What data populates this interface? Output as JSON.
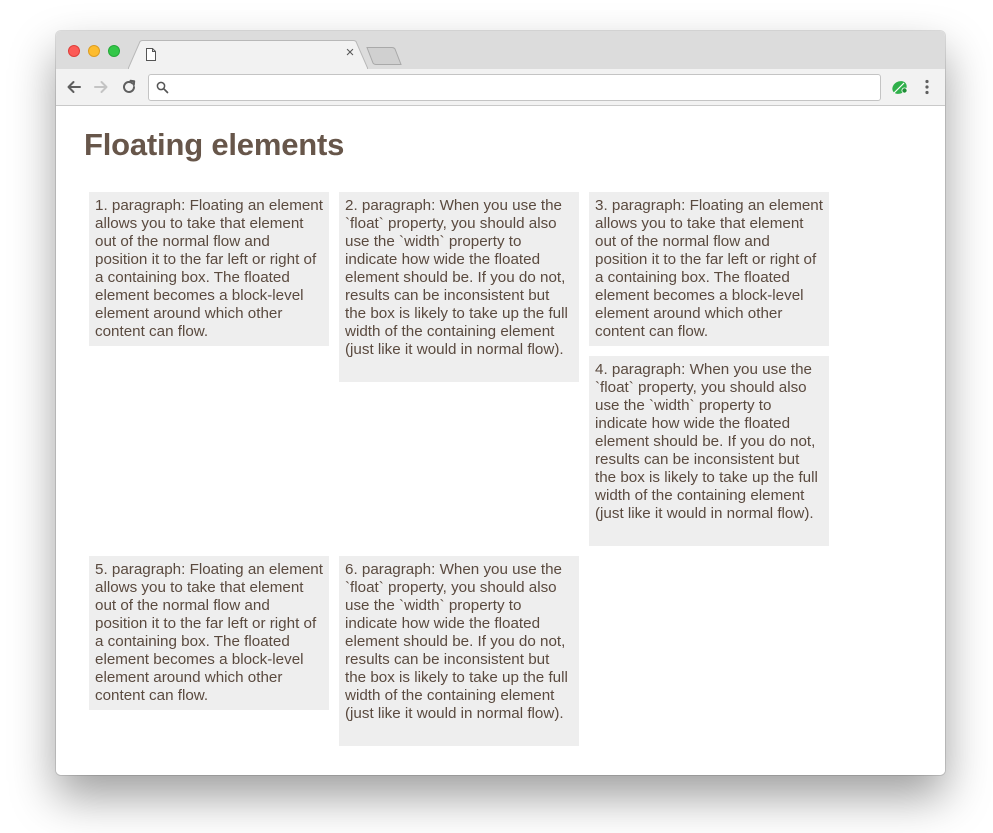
{
  "browser": {
    "tab_title": "",
    "tab_close_glyph": "×",
    "address_bar": {
      "value": "",
      "placeholder": ""
    },
    "icons": {
      "back": "arrow-left-icon",
      "forward": "arrow-right-icon",
      "reload": "reload-icon",
      "search": "search-icon",
      "extension": "extension-leaf-icon",
      "menu": "kebab-menu-icon",
      "document": "document-icon"
    },
    "colors": {
      "close": "#fc5b57",
      "minimize": "#fdbc2f",
      "maximize": "#33c748",
      "extension": "#2fb04a"
    }
  },
  "page": {
    "title": "Floating elements",
    "title_color": "#67564a",
    "paragraph_background": "#eeeeee",
    "paragraphs": [
      "1. paragraph: Floating an element allows you to take that element out of the normal flow and position it to the far left or right of a containing box. The floated element becomes a block-level element around which other content can flow.",
      "2. paragraph: When you use the `float` property, you should also use the `width` property to indicate how wide the floated element should be. If you do not, results can be inconsistent but the box is likely to take up the full width of the containing element (just like it would in normal flow).",
      "3. paragraph: Floating an element allows you to take that element out of the normal flow and position it to the far left or right of a containing box. The floated element becomes a block-level element around which other content can flow.",
      "4. paragraph: When you use the `float` property, you should also use the `width` property to indicate how wide the floated element should be. If you do not, results can be inconsistent but the box is likely to take up the full width of the containing element (just like it would in normal flow).",
      "5. paragraph: Floating an element allows you to take that element out of the normal flow and position it to the far left or right of a containing box. The floated element becomes a block-level element around which other content can flow.",
      "6. paragraph: When you use the `float` property, you should also use the `width` property to indicate how wide the floated element should be. If you do not, results can be inconsistent but the box is likely to take up the full width of the containing element (just like it would in normal flow)."
    ]
  }
}
